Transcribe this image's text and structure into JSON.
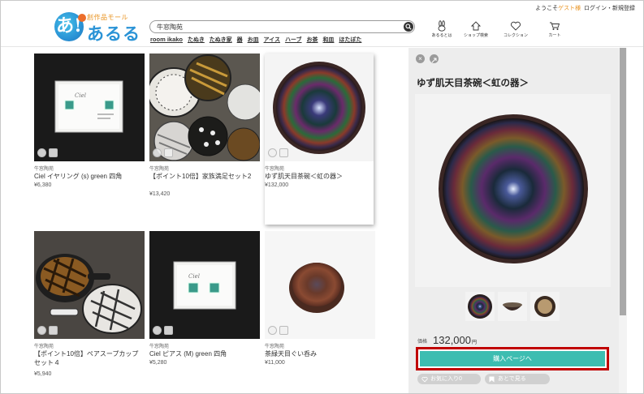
{
  "header": {
    "logo_sub": "創作品モール",
    "logo_name": "あるる",
    "logo_mark": "あ!",
    "search_value": "牛窓陶苑",
    "category_links": [
      "room ikako",
      "たぬき",
      "たぬき家",
      "器",
      "お皿",
      "アイス",
      "ハーブ",
      "お茶",
      "和皿",
      "ほたぼた"
    ],
    "welcome_prefix": "ようこそ",
    "welcome_guest": "ゲスト様",
    "login_link": "ログイン・新規登録",
    "nav_icons": [
      {
        "icon": "rabbit-icon",
        "label": "あるるとは"
      },
      {
        "icon": "shop-icon",
        "label": "ショップ検索"
      },
      {
        "icon": "heart-icon",
        "label": "コレクション"
      },
      {
        "icon": "cart-icon",
        "label": "カート"
      }
    ]
  },
  "products": [
    {
      "shop": "牛窓陶苑",
      "title": "Ciel イヤリング (s) green 四角",
      "price": "¥6,380"
    },
    {
      "shop": "牛窓陶苑",
      "title": "【ポイント10倍】家族満足セット2",
      "price": "¥13,420"
    },
    {
      "shop": "牛窓陶苑",
      "title": "ゆず肌天目茶碗＜虹の器＞",
      "price": "¥132,000"
    },
    {
      "shop": "牛窓陶苑",
      "title": "【ポイント10倍】ペアスープカップセット４",
      "price": "¥5,940"
    },
    {
      "shop": "牛窓陶苑",
      "title": "Ciel ピアス (M) green 四角",
      "price": "¥5,280"
    },
    {
      "shop": "牛窓陶苑",
      "title": "茶緑天目ぐい呑み",
      "price": "¥11,000"
    }
  ],
  "detail": {
    "title": "ゆず肌天目茶碗＜虹の器＞",
    "price_label": "価格",
    "price": "132,000",
    "price_unit": "円",
    "buy_button": "購入ページへ",
    "favorite_button": "お気に入り0",
    "later_button": "あとで見る"
  },
  "colors": {
    "accent": "#3dbdb1",
    "highlight_outline": "#c00000",
    "logo_blue": "#2a93d6",
    "logo_orange": "#e9911c"
  }
}
